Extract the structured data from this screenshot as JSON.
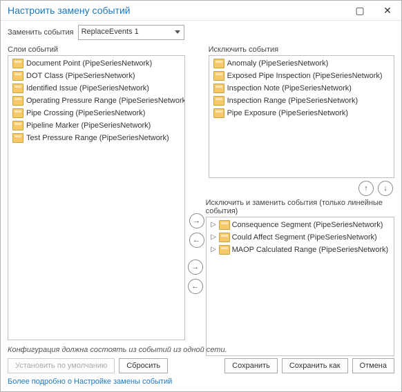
{
  "title": "Настроить замену событий",
  "config_label": "Заменить события",
  "config_value": "ReplaceEvents 1",
  "left": {
    "label": "Слои событий",
    "items": [
      "Document Point (PipeSeriesNetwork)",
      "DOT Class (PipeSeriesNetwork)",
      "Identified Issue (PipeSeriesNetwork)",
      "Operating Pressure Range (PipeSeriesNetwork)",
      "Pipe Crossing (PipeSeriesNetwork)",
      "Pipeline Marker (PipeSeriesNetwork)",
      "Test Pressure Range (PipeSeriesNetwork)"
    ]
  },
  "right_top": {
    "label": "Исключить события",
    "items": [
      "Anomaly (PipeSeriesNetwork)",
      "Exposed Pipe Inspection (PipeSeriesNetwork)",
      "Inspection Note (PipeSeriesNetwork)",
      "Inspection Range (PipeSeriesNetwork)",
      "Pipe Exposure (PipeSeriesNetwork)"
    ]
  },
  "right_bottom": {
    "label": "Исключить и заменить события (только линейные события)",
    "items": [
      "Consequence Segment (PipeSeriesNetwork)",
      "Could Affect Segment (PipeSeriesNetwork)",
      "MAOP Calculated Range (PipeSeriesNetwork)"
    ]
  },
  "status_text": "Конфигурация должна состоять из событий из одной сети.",
  "buttons": {
    "set_default": "Установить по умолчанию",
    "reset": "Сбросить",
    "save": "Сохранить",
    "save_as": "Сохранить как",
    "cancel": "Отмена"
  },
  "help_link": "Более подробно о Настройке замены событий"
}
